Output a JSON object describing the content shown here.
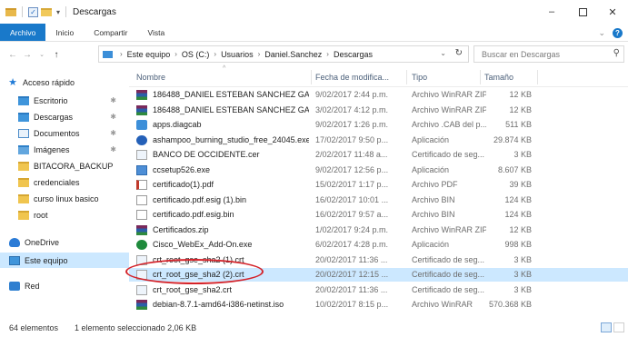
{
  "window": {
    "title": "Descargas",
    "controls": {
      "minimize": "–",
      "maximize": "□",
      "close": "✕"
    }
  },
  "ribbon": {
    "tabs": [
      {
        "label": "Archivo",
        "active": true
      },
      {
        "label": "Inicio",
        "active": false
      },
      {
        "label": "Compartir",
        "active": false
      },
      {
        "label": "Vista",
        "active": false
      }
    ]
  },
  "address": {
    "crumbs": [
      "Este equipo",
      "OS (C:)",
      "Usuarios",
      "Daniel.Sanchez",
      "Descargas"
    ],
    "search_placeholder": "Buscar en Descargas"
  },
  "nav": {
    "items": [
      {
        "label": "Acceso rápido",
        "icon": "star-icon"
      },
      {
        "label": "Escritorio",
        "icon": "folder-blue-icon",
        "pinned": true
      },
      {
        "label": "Descargas",
        "icon": "download-folder-icon",
        "pinned": true
      },
      {
        "label": "Documentos",
        "icon": "documents-icon",
        "pinned": true
      },
      {
        "label": "Imágenes",
        "icon": "pictures-icon",
        "pinned": true
      },
      {
        "label": "BITACORA_BACKUP",
        "icon": "folder-icon"
      },
      {
        "label": "credenciales",
        "icon": "folder-icon"
      },
      {
        "label": "curso linux basico",
        "icon": "folder-icon"
      },
      {
        "label": "root",
        "icon": "folder-icon"
      },
      {
        "label": "OneDrive",
        "icon": "cloud-icon"
      },
      {
        "label": "Este equipo",
        "icon": "computer-icon",
        "selected": true
      },
      {
        "label": "Red",
        "icon": "network-icon"
      }
    ]
  },
  "columns": {
    "name": "Nombre",
    "date": "Fecha de modifica...",
    "type": "Tipo",
    "size": "Tamaño"
  },
  "files": [
    {
      "name": "186488_DANIEL ESTEBAN SANCHEZ GA...",
      "date": "9/02/2017 2:44 p.m.",
      "type": "Archivo WinRAR ZIP",
      "size": "12 KB",
      "icon": "winrar-zip-icon"
    },
    {
      "name": "186488_DANIEL ESTEBAN SANCHEZ GA...",
      "date": "3/02/2017 4:12 p.m.",
      "type": "Archivo WinRAR ZIP",
      "size": "12 KB",
      "icon": "winrar-zip-icon"
    },
    {
      "name": "apps.diagcab",
      "date": "9/02/2017 1:26 p.m.",
      "type": "Archivo .CAB del p...",
      "size": "511 KB",
      "icon": "diagcab-icon"
    },
    {
      "name": "ashampoo_burning_studio_free_24045.exe",
      "date": "17/02/2017 9:50 p...",
      "type": "Aplicación",
      "size": "29.874 KB",
      "icon": "ashampoo-icon"
    },
    {
      "name": "BANCO DE OCCIDENTE.cer",
      "date": "2/02/2017 11:48 a...",
      "type": "Certificado de seg...",
      "size": "3 KB",
      "icon": "certificate-icon"
    },
    {
      "name": "ccsetup526.exe",
      "date": "9/02/2017 12:56 p...",
      "type": "Aplicación",
      "size": "8.607 KB",
      "icon": "exe-icon"
    },
    {
      "name": "certificado(1).pdf",
      "date": "15/02/2017 1:17 p...",
      "type": "Archivo PDF",
      "size": "39 KB",
      "icon": "pdf-icon"
    },
    {
      "name": "certificado.pdf.esig (1).bin",
      "date": "16/02/2017 10:01 ...",
      "type": "Archivo BIN",
      "size": "124 KB",
      "icon": "bin-icon"
    },
    {
      "name": "certificado.pdf.esig.bin",
      "date": "16/02/2017 9:57 a...",
      "type": "Archivo BIN",
      "size": "124 KB",
      "icon": "bin-icon"
    },
    {
      "name": "Certificados.zip",
      "date": "1/02/2017 9:24 p.m.",
      "type": "Archivo WinRAR ZIP",
      "size": "12 KB",
      "icon": "winrar-zip-icon"
    },
    {
      "name": "Cisco_WebEx_Add-On.exe",
      "date": "6/02/2017 4:28 p.m.",
      "type": "Aplicación",
      "size": "998 KB",
      "icon": "webex-icon"
    },
    {
      "name": "crt_root_gse_sha2 (1).crt",
      "date": "20/02/2017 11:36 ...",
      "type": "Certificado de seg...",
      "size": "3 KB",
      "icon": "certificate-icon"
    },
    {
      "name": "crt_root_gse_sha2 (2).crt",
      "date": "20/02/2017 12:15 ...",
      "type": "Certificado de seg...",
      "size": "3 KB",
      "icon": "certificate-icon",
      "selected": true
    },
    {
      "name": "crt_root_gse_sha2.crt",
      "date": "20/02/2017 11:36 ...",
      "type": "Certificado de seg...",
      "size": "3 KB",
      "icon": "certificate-icon"
    },
    {
      "name": "debian-8.7.1-amd64-i386-netinst.iso",
      "date": "10/02/2017 8:15 p...",
      "type": "Archivo WinRAR",
      "size": "570.368 KB",
      "icon": "iso-icon"
    }
  ],
  "status": {
    "count": "64 elementos",
    "selection": "1 elemento seleccionado  2,06 KB"
  },
  "colors": {
    "accent": "#1979ca",
    "selection": "#cce8ff",
    "annotation": "#d4232a"
  }
}
